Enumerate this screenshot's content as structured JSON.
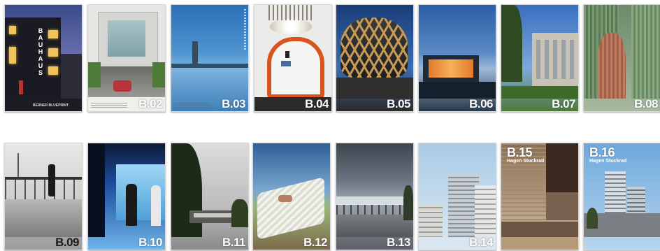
{
  "covers": [
    {
      "label": "",
      "word": "BAUHAUS",
      "tagline": "BERNER BLUEPRINT"
    },
    {
      "label": "B.02"
    },
    {
      "label": "B.03"
    },
    {
      "label": "B.04"
    },
    {
      "label": "B.05"
    },
    {
      "label": "B.06"
    },
    {
      "label": "B.07"
    },
    {
      "label": "B.08"
    },
    {
      "label": "B.09"
    },
    {
      "label": "B.10"
    },
    {
      "label": "B.11"
    },
    {
      "label": "B.12"
    },
    {
      "label": "B.13"
    },
    {
      "label": "B.14"
    },
    {
      "label": "B.15",
      "subtitle": "Hagen Stuckrad"
    },
    {
      "label": "B.16",
      "subtitle": "Hagen Stuckrad"
    }
  ]
}
